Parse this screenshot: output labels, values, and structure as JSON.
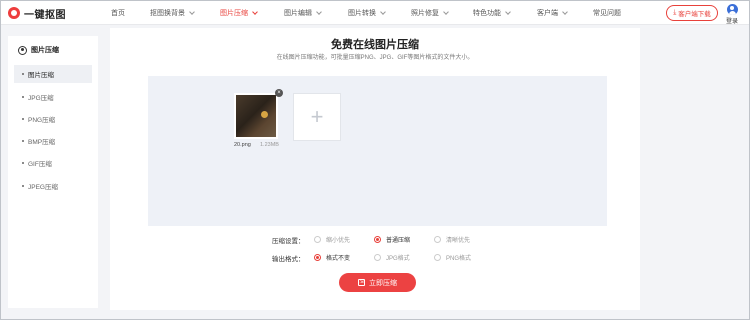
{
  "header": {
    "logo_text": "一键抠图",
    "nav": [
      {
        "label": "首页",
        "has_menu": false,
        "active": false
      },
      {
        "label": "抠图换背景",
        "has_menu": true,
        "active": false
      },
      {
        "label": "图片压缩",
        "has_menu": true,
        "active": true
      },
      {
        "label": "图片编辑",
        "has_menu": true,
        "active": false
      },
      {
        "label": "图片转换",
        "has_menu": true,
        "active": false
      },
      {
        "label": "照片修复",
        "has_menu": true,
        "active": false
      },
      {
        "label": "特色功能",
        "has_menu": true,
        "active": false
      },
      {
        "label": "客户端",
        "has_menu": true,
        "active": false
      },
      {
        "label": "常见问题",
        "has_menu": false,
        "active": false
      }
    ],
    "download_label": "客户端下载",
    "login_label": "登录"
  },
  "sidebar": {
    "title": "图片压缩",
    "items": [
      {
        "label": "图片压缩",
        "active": true
      },
      {
        "label": "JPG压缩",
        "active": false
      },
      {
        "label": "PNG压缩",
        "active": false
      },
      {
        "label": "BMP压缩",
        "active": false
      },
      {
        "label": "GIF压缩",
        "active": false
      },
      {
        "label": "JPEG压缩",
        "active": false
      }
    ]
  },
  "main": {
    "title": "免费在线图片压缩",
    "subtitle": "在线图片压缩功能，可批量压缩PNG、JPG、GIF等图片格式的文件大小。",
    "file": {
      "name": "20.png",
      "size": "1.23MB"
    },
    "compress_settings": {
      "label": "压缩设置：",
      "options": [
        {
          "label": "缩小优先",
          "checked": false
        },
        {
          "label": "普通压缩",
          "checked": true
        },
        {
          "label": "清晰优先",
          "checked": false
        }
      ]
    },
    "output_format": {
      "label": "输出格式：",
      "options": [
        {
          "label": "格式不变",
          "checked": true
        },
        {
          "label": "JPG格式",
          "checked": false
        },
        {
          "label": "PNG格式",
          "checked": false
        }
      ]
    },
    "compress_button": "立即压缩"
  },
  "colors": {
    "accent": "#e8413b",
    "upload_bg": "#eef1f7"
  }
}
